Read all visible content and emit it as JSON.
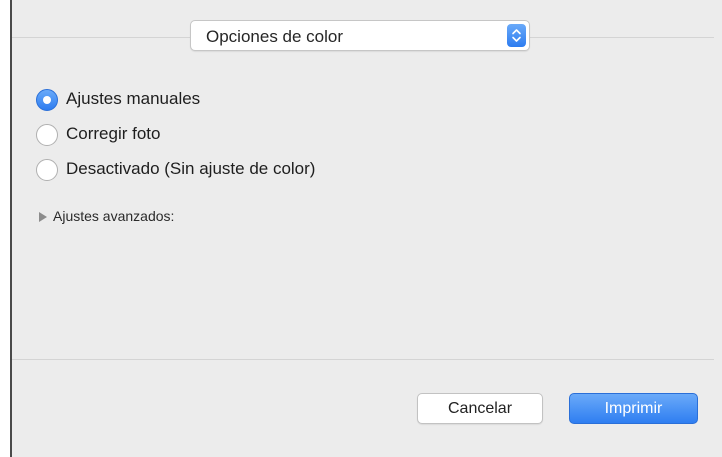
{
  "popup": {
    "selected": "Opciones de color"
  },
  "radios": [
    {
      "label": "Ajustes manuales",
      "checked": true
    },
    {
      "label": "Corregir foto",
      "checked": false
    },
    {
      "label": "Desactivado (Sin ajuste de color)",
      "checked": false
    }
  ],
  "advanced": {
    "label": "Ajustes avanzados:",
    "expanded": false
  },
  "buttons": {
    "cancel": "Cancelar",
    "print": "Imprimir"
  },
  "colors": {
    "accent": "#3b8bf6",
    "panel": "#ececec"
  }
}
